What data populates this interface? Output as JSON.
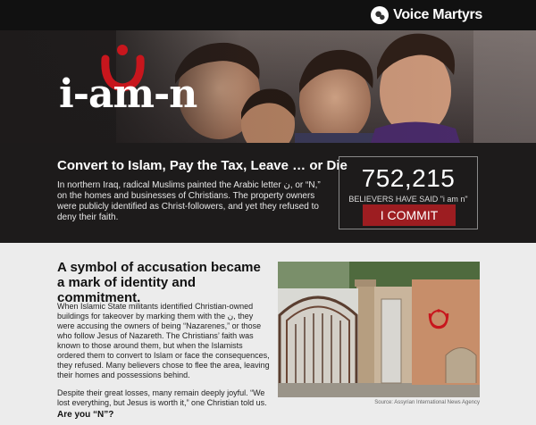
{
  "brand": {
    "name": "Voice Martyrs",
    "icon": "globe-icon"
  },
  "hero": {
    "title": "i-am-n",
    "symbol_color": "#c8161d"
  },
  "band": {
    "heading": "Convert to Islam, Pay the Tax, Leave … or Die",
    "body": "In northern Iraq, radical Muslims painted the Arabic letter ن, or “N,” on the homes and businesses of Christians. The property owners were publicly identified as Christ-followers, and yet they refused to deny their faith."
  },
  "counter": {
    "count": "752,215",
    "label": "BELIEVERS HAVE SAID \"i am n\"",
    "button_label": "I COMMIT",
    "button_color": "#9d1d21"
  },
  "article": {
    "heading": "A symbol of accusation became a mark of identity and commitment.",
    "paragraph_1": "When Islamic State militants identified Christian-owned buildings for takeover by marking them with the ن, they were accusing the owners of being “Nazarenes,” or those who follow Jesus of Nazareth. The Christians’ faith was known to those around them, but when the Islamists ordered them to convert to Islam or face the consequences, they refused. Many believers chose to flee the area, leaving their homes and possessions behind.",
    "paragraph_2": "Despite their great losses, many remain deeply joyful. “We lost everything, but Jesus is worth it,” one Christian told us.",
    "question": "Are you “N”?",
    "photo_caption": "Source: Assyrian International News Agency"
  }
}
